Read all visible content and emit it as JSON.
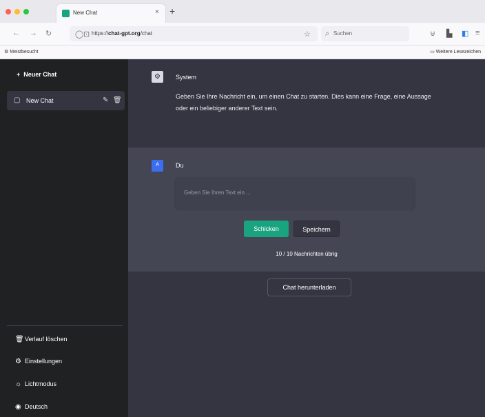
{
  "browser": {
    "tab_title": "New Chat",
    "tab_close": "×",
    "new_tab": "+",
    "url_prefix": "https://",
    "url_domain": "chat-gpt.org",
    "url_path": "/chat",
    "search_placeholder": "Suchen",
    "bookmarks_left": "Meistbesucht",
    "bookmarks_right": "Weitere Lesezeichen",
    "traffic_colors": [
      "#ff5f57",
      "#febc2e",
      "#28c840"
    ]
  },
  "sidebar": {
    "new_chat_label": "Neuer Chat",
    "conversation": {
      "label": "New Chat"
    },
    "bottom_items": [
      {
        "label": "Verlauf löschen",
        "icon": "trash-icon"
      },
      {
        "label": "Einstellungen",
        "icon": "gear-icon"
      },
      {
        "label": "Lichtmodus",
        "icon": "sun-icon"
      },
      {
        "label": "Deutsch",
        "icon": "globe-icon"
      }
    ]
  },
  "system_message": {
    "role": "System",
    "text": "Geben Sie Ihre Nachricht ein, um einen Chat zu starten. Dies kann eine Frage, eine Aussage oder ein beliebiger anderer Text sein."
  },
  "user_message": {
    "role": "Du",
    "input_placeholder": "Geben Sie Ihren Text ein ...",
    "send_label": "Schicken",
    "save_label": "Speichern",
    "remaining": "10 / 10 Nachrichten übrig"
  },
  "download_label": "Chat herunterladen",
  "colors": {
    "accent": "#19a37f",
    "user_avatar": "#3b6ef0",
    "sidebar_bg": "#202123"
  }
}
